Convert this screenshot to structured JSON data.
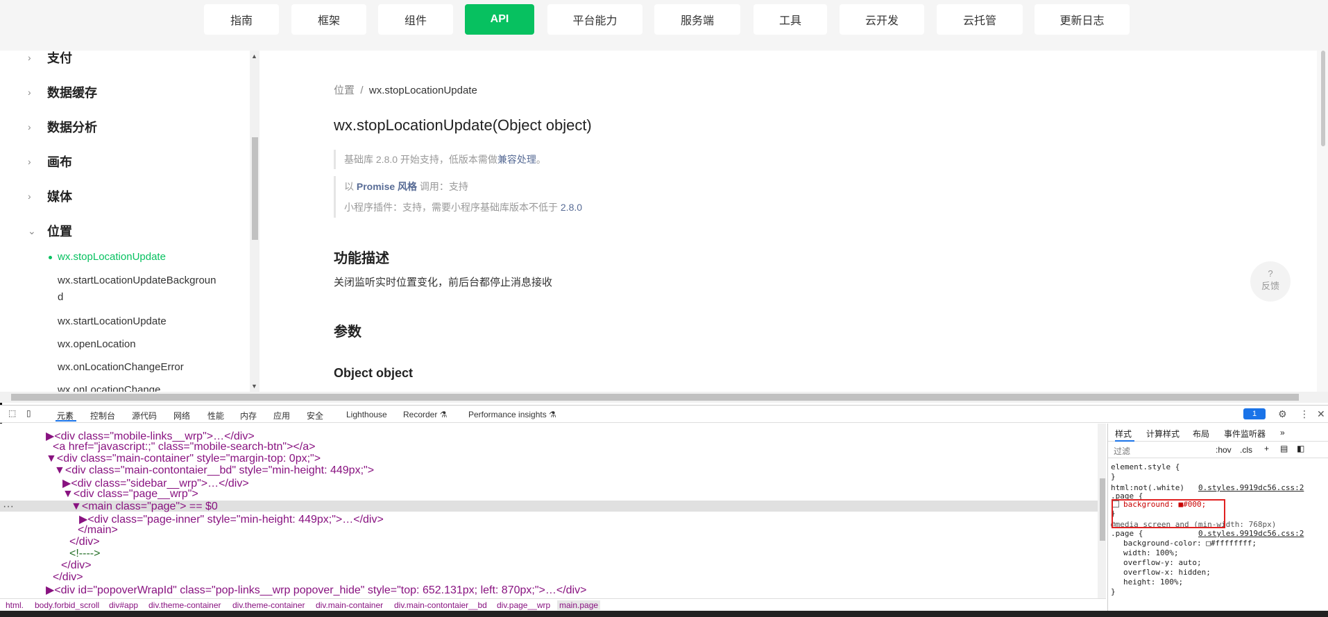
{
  "nav": {
    "items": [
      "指南",
      "框架",
      "组件",
      "API",
      "平台能力",
      "服务端",
      "工具",
      "云开发",
      "云托管",
      "更新日志"
    ],
    "active": "API"
  },
  "sidebar": {
    "groups": [
      {
        "label": "支付",
        "chevron": "›"
      },
      {
        "label": "数据缓存",
        "chevron": "›"
      },
      {
        "label": "数据分析",
        "chevron": "›"
      },
      {
        "label": "画布",
        "chevron": "›"
      },
      {
        "label": "媒体",
        "chevron": "›"
      },
      {
        "label": "位置",
        "chevron": "⌄"
      }
    ],
    "items": [
      "wx.stopLocationUpdate",
      "wx.startLocationUpdateBackgroun",
      "d",
      "wx.startLocationUpdate",
      "wx.openLocation",
      "wx.onLocationChangeError",
      "wx.onLocationChange"
    ]
  },
  "content": {
    "breadcrumb_parent": "位置",
    "breadcrumb_sep": "/",
    "breadcrumb_current": "wx.stopLocationUpdate",
    "title": "wx.stopLocationUpdate(Object object)",
    "quote1_prefix": "基础库 2.8.0 开始支持，低版本需做",
    "quote1_link": "兼容处理",
    "quote1_suffix": "。",
    "quote2_a": "以 ",
    "quote2_promise": "Promise 风格",
    "quote2_b": " 调用：支持",
    "quote3_a": "小程序插件：支持，需要小程序基础库版本不低于 ",
    "quote3_ver": "2.8.0",
    "h_desc": "功能描述",
    "desc": "关闭监听实时位置变化，前后台都停止消息接收",
    "h_params": "参数",
    "h_object": "Object object",
    "feedback_q": "?",
    "feedback_label": "反馈"
  },
  "devtools": {
    "tabs": [
      "元素",
      "控制台",
      "源代码",
      "网络",
      "性能",
      "内存",
      "应用",
      "安全",
      "Lighthouse",
      "Recorder ⚗",
      "Performance insights ⚗"
    ],
    "badge": "1",
    "elements": [
      {
        "t": "<div class=\"mobile-links__wrp\">…</div>"
      },
      {
        "t": "<a href=\"javascript:;\" class=\"mobile-search-btn\"></a>"
      },
      {
        "t": "<div class=\"main-container\" style=\"margin-top: 0px;\">"
      },
      {
        "t": "<div class=\"main-contontaier__bd\" style=\"min-height: 449px;\">"
      },
      {
        "t": "<div class=\"sidebar__wrp\">…</div>"
      },
      {
        "t": "<div class=\"page__wrp\">"
      },
      {
        "t": "<main class=\"page\"> == $0"
      },
      {
        "t": "<div class=\"page-inner\" style=\"min-height: 449px;\">…</div>"
      },
      {
        "t": "</main>"
      },
      {
        "t": "</div>"
      },
      {
        "t": "<!---->"
      },
      {
        "t": "</div>"
      },
      {
        "t": "</div>"
      },
      {
        "t": "<div id=\"popoverWrapId\" class=\"pop-links__wrp popover_hide\" style=\"top: 652.131px; left: 870px;\">…</div>"
      }
    ],
    "breadcrumbs": [
      "html.",
      "body.forbid_scroll",
      "div#app",
      "div.theme-container",
      "div.theme-container",
      "div.main-container",
      "div.main-contontaier__bd",
      "div.page__wrp",
      "main.page"
    ],
    "styles_tabs": [
      "样式",
      "计算样式",
      "布局",
      "事件监听器",
      "»"
    ],
    "filter_placeholder": "过滤",
    "hov": ":hov",
    "cls": ".cls",
    "rules": [
      "element.style {",
      "}",
      "html:not(.white)",
      ".page {",
      "background: ■#000;",
      "}",
      "@media screen and (min-width: 768px)",
      ".page {",
      "background-color: □#ffffffff;",
      "width: 100%;",
      "overflow-y: auto;",
      "overflow-x: hidden;",
      "height: 100%;",
      "}"
    ],
    "source1": "0.styles.9919dc56.css:2",
    "source2": "0.styles.9919dc56.css:2"
  }
}
